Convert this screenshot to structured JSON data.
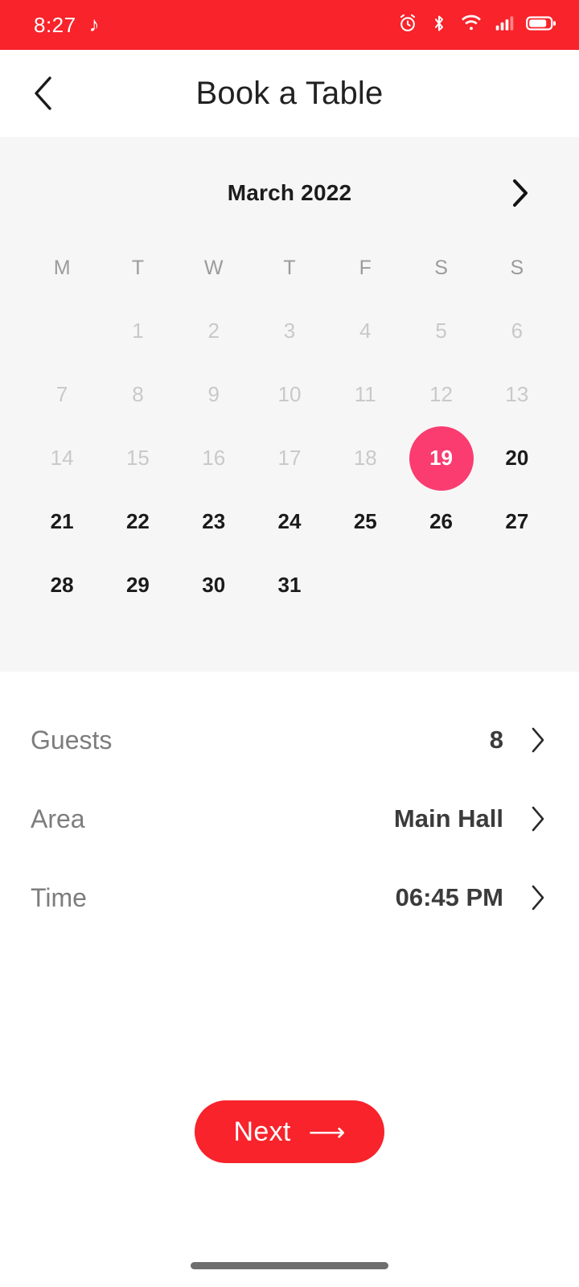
{
  "status_bar": {
    "time": "8:27",
    "music_glyph": "♪",
    "background_color": "#F8232B",
    "icons": [
      "alarm-icon",
      "bluetooth-icon",
      "wifi-icon",
      "cellular-signal-icon",
      "battery-icon"
    ]
  },
  "header": {
    "back_glyph": "‹",
    "title": "Book a Table"
  },
  "calendar": {
    "month_label": "March 2022",
    "next_month_glyph": "›",
    "weekday_labels": [
      "M",
      "T",
      "W",
      "T",
      "F",
      "S",
      "S"
    ],
    "selected_day": "19",
    "selected_color": "#FA3C70",
    "panel_background": "#F6F6F6",
    "weeks": [
      [
        {
          "label": "",
          "state": "empty"
        },
        {
          "label": "1",
          "state": "disabled"
        },
        {
          "label": "2",
          "state": "disabled"
        },
        {
          "label": "3",
          "state": "disabled"
        },
        {
          "label": "4",
          "state": "disabled"
        },
        {
          "label": "5",
          "state": "disabled"
        },
        {
          "label": "6",
          "state": "disabled"
        }
      ],
      [
        {
          "label": "7",
          "state": "disabled"
        },
        {
          "label": "8",
          "state": "disabled"
        },
        {
          "label": "9",
          "state": "disabled"
        },
        {
          "label": "10",
          "state": "disabled"
        },
        {
          "label": "11",
          "state": "disabled"
        },
        {
          "label": "12",
          "state": "disabled"
        },
        {
          "label": "13",
          "state": "disabled"
        }
      ],
      [
        {
          "label": "14",
          "state": "disabled"
        },
        {
          "label": "15",
          "state": "disabled"
        },
        {
          "label": "16",
          "state": "disabled"
        },
        {
          "label": "17",
          "state": "disabled"
        },
        {
          "label": "18",
          "state": "disabled"
        },
        {
          "label": "19",
          "state": "selected"
        },
        {
          "label": "20",
          "state": "enabled"
        }
      ],
      [
        {
          "label": "21",
          "state": "enabled"
        },
        {
          "label": "22",
          "state": "enabled"
        },
        {
          "label": "23",
          "state": "enabled"
        },
        {
          "label": "24",
          "state": "enabled"
        },
        {
          "label": "25",
          "state": "enabled"
        },
        {
          "label": "26",
          "state": "enabled"
        },
        {
          "label": "27",
          "state": "enabled"
        }
      ],
      [
        {
          "label": "28",
          "state": "enabled"
        },
        {
          "label": "29",
          "state": "enabled"
        },
        {
          "label": "30",
          "state": "enabled"
        },
        {
          "label": "31",
          "state": "enabled"
        },
        {
          "label": "",
          "state": "empty"
        },
        {
          "label": "",
          "state": "empty"
        },
        {
          "label": "",
          "state": "empty"
        }
      ]
    ]
  },
  "options": [
    {
      "name": "guests",
      "label": "Guests",
      "value": "8",
      "chevron": "›"
    },
    {
      "name": "area",
      "label": "Area",
      "value": "Main Hall",
      "chevron": "›"
    },
    {
      "name": "time",
      "label": "Time",
      "value": "06:45 PM",
      "chevron": "›"
    }
  ],
  "cta": {
    "label": "Next",
    "arrow_glyph": "⟶",
    "color": "#F8232B"
  }
}
